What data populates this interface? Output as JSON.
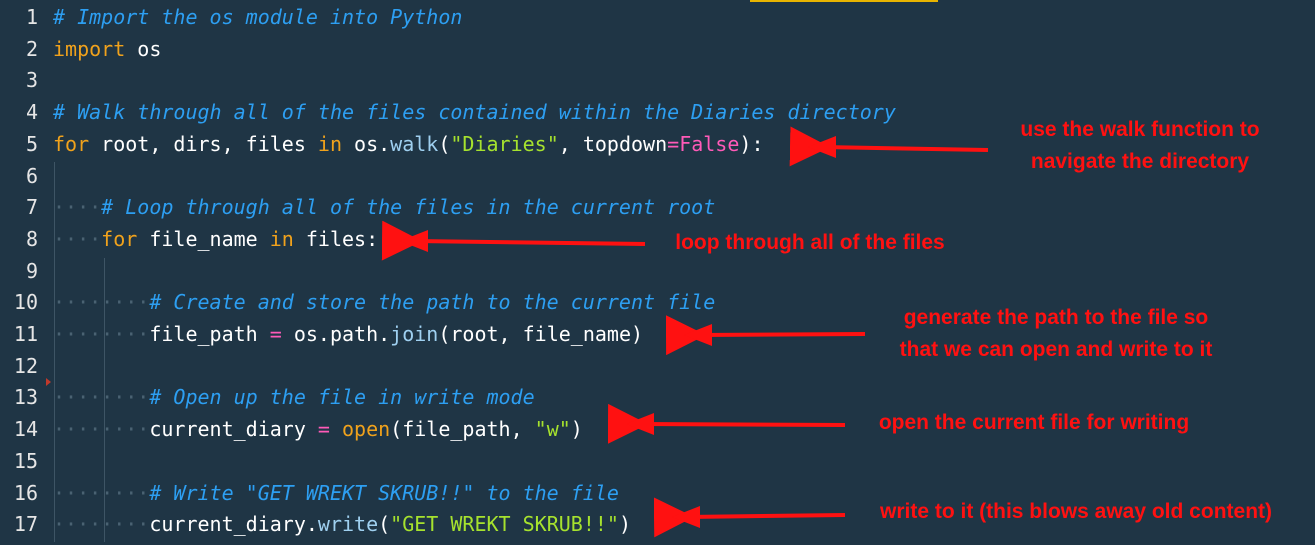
{
  "editor": {
    "lines": [
      {
        "num": "1",
        "indent": "",
        "tokens": [
          {
            "t": "cmt",
            "v": "# Import the os module into Python"
          }
        ]
      },
      {
        "num": "2",
        "indent": "",
        "tokens": [
          {
            "t": "kw",
            "v": "import"
          },
          {
            "t": "id",
            "v": " os"
          }
        ]
      },
      {
        "num": "3",
        "indent": "",
        "tokens": []
      },
      {
        "num": "4",
        "indent": "",
        "tokens": [
          {
            "t": "cmt",
            "v": "# Walk through all of the files contained within the Diaries directory"
          }
        ]
      },
      {
        "num": "5",
        "indent": "",
        "tokens": [
          {
            "t": "kw",
            "v": "for"
          },
          {
            "t": "id",
            "v": " root, dirs, files "
          },
          {
            "t": "kw",
            "v": "in"
          },
          {
            "t": "id",
            "v": " os."
          },
          {
            "t": "fn",
            "v": "walk"
          },
          {
            "t": "id",
            "v": "("
          },
          {
            "t": "str",
            "v": "\"Diaries\""
          },
          {
            "t": "id",
            "v": ", topdown"
          },
          {
            "t": "op",
            "v": "="
          },
          {
            "t": "bool",
            "v": "False"
          },
          {
            "t": "id",
            "v": "):"
          }
        ]
      },
      {
        "num": "6",
        "indent": "",
        "tokens": []
      },
      {
        "num": "7",
        "indent": "····",
        "tokens": [
          {
            "t": "cmt",
            "v": "# Loop through all of the files in the current root"
          }
        ]
      },
      {
        "num": "8",
        "indent": "····",
        "tokens": [
          {
            "t": "kw",
            "v": "for"
          },
          {
            "t": "id",
            "v": " file_name "
          },
          {
            "t": "kw",
            "v": "in"
          },
          {
            "t": "id",
            "v": " files:"
          }
        ]
      },
      {
        "num": "9",
        "indent": "",
        "tokens": []
      },
      {
        "num": "10",
        "indent": "········",
        "tokens": [
          {
            "t": "cmt",
            "v": "# Create and store the path to the current file"
          }
        ]
      },
      {
        "num": "11",
        "indent": "········",
        "tokens": [
          {
            "t": "id",
            "v": "file_path "
          },
          {
            "t": "op",
            "v": "="
          },
          {
            "t": "id",
            "v": " os.path."
          },
          {
            "t": "fn",
            "v": "join"
          },
          {
            "t": "id",
            "v": "(root, file_name)"
          }
        ]
      },
      {
        "num": "12",
        "indent": "",
        "tokens": []
      },
      {
        "num": "13",
        "indent": "········",
        "tokens": [
          {
            "t": "cmt",
            "v": "# Open up the file in write mode"
          }
        ]
      },
      {
        "num": "14",
        "indent": "········",
        "tokens": [
          {
            "t": "id",
            "v": "current_diary "
          },
          {
            "t": "op",
            "v": "="
          },
          {
            "t": "id",
            "v": " "
          },
          {
            "t": "kw",
            "v": "open"
          },
          {
            "t": "id",
            "v": "(file_path, "
          },
          {
            "t": "str",
            "v": "\"w\""
          },
          {
            "t": "id",
            "v": ")"
          }
        ]
      },
      {
        "num": "15",
        "indent": "",
        "tokens": []
      },
      {
        "num": "16",
        "indent": "········",
        "tokens": [
          {
            "t": "cmt",
            "v": "# Write \"GET WREKT SKRUB!!\" to the file"
          }
        ]
      },
      {
        "num": "17",
        "indent": "········",
        "tokens": [
          {
            "t": "id",
            "v": "current_diary."
          },
          {
            "t": "fn",
            "v": "write"
          },
          {
            "t": "id",
            "v": "("
          },
          {
            "t": "str",
            "v": "\"GET WREKT SKRUB!!\""
          },
          {
            "t": "id",
            "v": ")"
          }
        ]
      }
    ]
  },
  "annotations": {
    "walk": "use the walk function to\nnavigate the directory",
    "loop": "loop through all of the files",
    "path": "generate the path to the file so\nthat we can open and write to it",
    "open": "open the current file for writing",
    "write": "write to it (this blows away old content)"
  },
  "colors": {
    "background": "#1f3545",
    "comment": "#2d9ff2",
    "keyword": "#f0a21c",
    "string": "#a6e22e",
    "annotation": "#ff1111"
  }
}
